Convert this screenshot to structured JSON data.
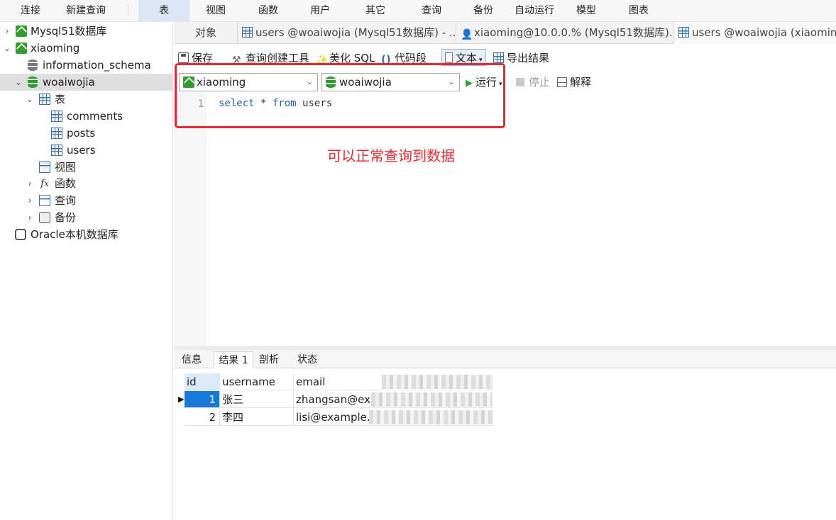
{
  "menu": [
    "连接",
    "新建查询",
    "表",
    "视图",
    "函数",
    "用户",
    "其它",
    "查询",
    "备份",
    "自动运行",
    "模型",
    "图表"
  ],
  "sidebar": {
    "items": [
      {
        "label": "Mysql51数据库"
      },
      {
        "label": "xiaoming"
      },
      {
        "label": "information_schema"
      },
      {
        "label": "woaiwojia"
      },
      {
        "label": "表"
      },
      {
        "label": "comments"
      },
      {
        "label": "posts"
      },
      {
        "label": "users"
      },
      {
        "label": "视图"
      },
      {
        "label": "函数"
      },
      {
        "label": "查询"
      },
      {
        "label": "备份"
      },
      {
        "label": "Oracle本机数据库"
      }
    ]
  },
  "tabs": [
    "对象",
    "users @woaiwojia (Mysql51数据库) - ...",
    "xiaoming@10.0.0.% (Mysql51数据库)...",
    "users @woaiwojia (xiaoming)"
  ],
  "toolbar": {
    "save": "保存",
    "query_builder": "查询创建工具",
    "beautify": "美化 SQL",
    "snippet": "代码段",
    "text": "文本",
    "export": "导出结果",
    "connection": "xiaoming",
    "database": "woaiwojia",
    "run": "运行",
    "stop": "停止",
    "explain": "解释"
  },
  "editor": {
    "line_number": "1",
    "kw_select": "select",
    "star": " * ",
    "kw_from": "from",
    "table": " users"
  },
  "annotation": "可以正常查询到数据",
  "result_tabs": [
    "信息",
    "结果 1",
    "剖析",
    "状态"
  ],
  "grid": {
    "columns": [
      "id",
      "username",
      "email"
    ],
    "rows": [
      {
        "id": "1",
        "username": "张三",
        "email": "zhangsan@ex"
      },
      {
        "id": "2",
        "username": "李四",
        "email": "lisi@example."
      }
    ]
  },
  "colors": {
    "accent": "#1479d8",
    "annotation": "#e8292f",
    "mysql": "#2f9e2f"
  }
}
